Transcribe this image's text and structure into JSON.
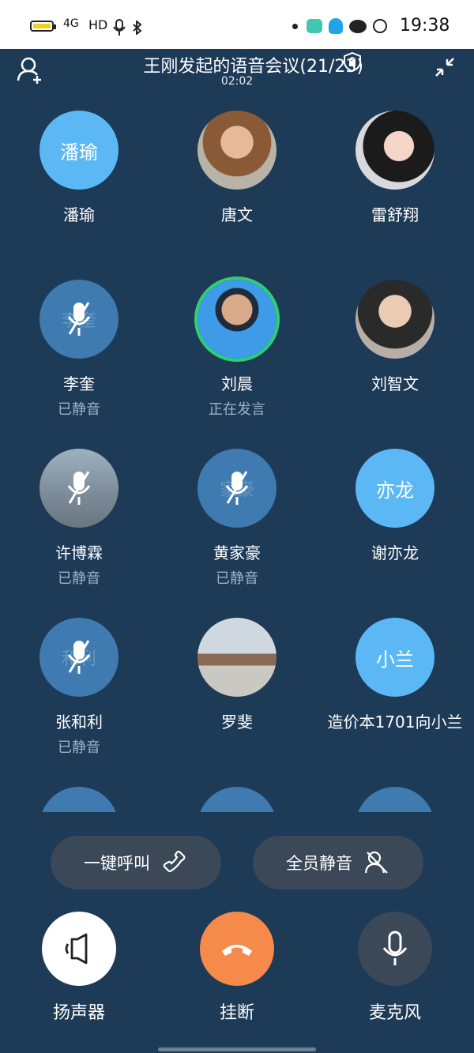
{
  "status_bar": {
    "time": "19:38",
    "network": "HD",
    "signal": "4G"
  },
  "header": {
    "title": "王刚发起的语音会议(21/23)",
    "timer": "02:02"
  },
  "participants": [
    {
      "name": "潘瑜",
      "status": "",
      "avatar_text": "潘瑜",
      "avatar_type": "text"
    },
    {
      "name": "唐文",
      "status": "",
      "avatar_text": "",
      "avatar_type": "photo"
    },
    {
      "name": "雷舒翔",
      "status": "",
      "avatar_text": "",
      "avatar_type": "photo"
    },
    {
      "name": "李奎",
      "status": "已静音",
      "avatar_text": "李奎",
      "avatar_type": "muted"
    },
    {
      "name": "刘晨",
      "status": "正在发言",
      "avatar_text": "",
      "avatar_type": "photo-speaking"
    },
    {
      "name": "刘智文",
      "status": "",
      "avatar_text": "",
      "avatar_type": "photo"
    },
    {
      "name": "许博霖",
      "status": "已静音",
      "avatar_text": "",
      "avatar_type": "photo-muted"
    },
    {
      "name": "黄家豪",
      "status": "已静音",
      "avatar_text": "家豪",
      "avatar_type": "muted"
    },
    {
      "name": "谢亦龙",
      "status": "",
      "avatar_text": "亦龙",
      "avatar_type": "text"
    },
    {
      "name": "张和利",
      "status": "已静音",
      "avatar_text": "和利",
      "avatar_type": "muted"
    },
    {
      "name": "罗斐",
      "status": "",
      "avatar_text": "",
      "avatar_type": "photo"
    },
    {
      "name": "造价本1701向小兰",
      "status": "",
      "avatar_text": "小兰",
      "avatar_type": "text"
    }
  ],
  "actions": {
    "call_all": "一键呼叫",
    "mute_all": "全员静音"
  },
  "controls": {
    "speaker": "扬声器",
    "hangup": "挂断",
    "microphone": "麦克风"
  },
  "colors": {
    "background": "#1d3a57",
    "avatar_blue": "#5bb8f5",
    "muted_blue": "#3f7ab0",
    "hangup": "#f58a4b",
    "speaking_ring": "#2ecf72"
  }
}
